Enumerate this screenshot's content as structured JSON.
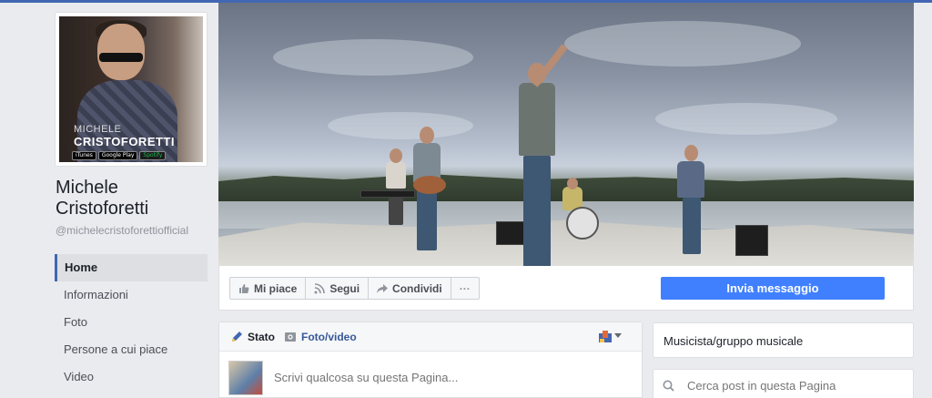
{
  "page": {
    "name": "Michele Cristoforetti",
    "handle": "@michelecristoforettiofficial",
    "category": "Musicista/gruppo musicale"
  },
  "profile_picture": {
    "overlay_line1": "MICHELE",
    "overlay_line2": "CRISTOFORETTI",
    "store_badges": [
      "iTunes",
      "Google Play",
      "Spotify"
    ]
  },
  "sidebar": {
    "items": [
      {
        "label": "Home",
        "active": true
      },
      {
        "label": "Informazioni"
      },
      {
        "label": "Foto"
      },
      {
        "label": "Persone a cui piace"
      },
      {
        "label": "Video"
      }
    ]
  },
  "actions": {
    "like_label": "Mi piace",
    "follow_label": "Segui",
    "share_label": "Condividi",
    "more_label": "···",
    "send_message_label": "Invia messaggio"
  },
  "composer": {
    "tab_status": "Stato",
    "tab_photo": "Foto/video",
    "placeholder": "Scrivi qualcosa su questa Pagina..."
  },
  "search": {
    "placeholder": "Cerca post in questa Pagina"
  },
  "colors": {
    "accent": "#4267b2",
    "button_blue": "#4080ff",
    "background": "#e9ebee"
  }
}
